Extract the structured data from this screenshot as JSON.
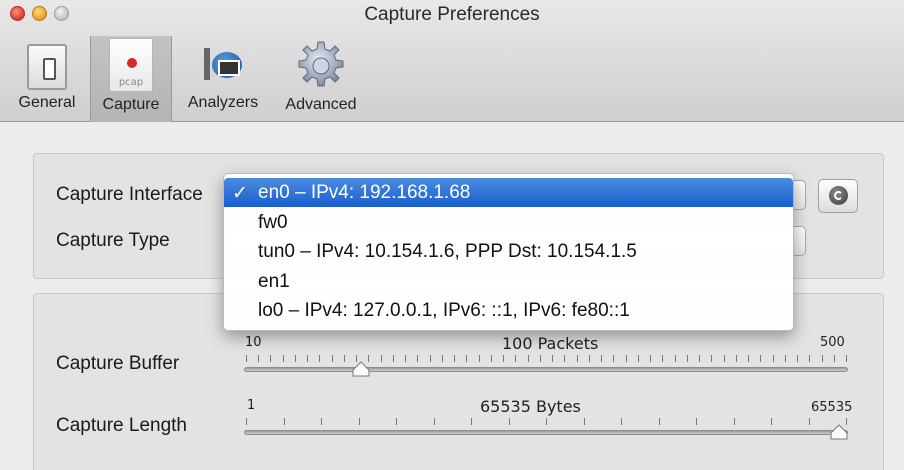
{
  "window": {
    "title": "Capture Preferences"
  },
  "toolbar": {
    "items": [
      {
        "label": "General",
        "icon": "switch-icon"
      },
      {
        "label": "Capture",
        "icon": "pcap-document-icon",
        "icon_text": "pcap",
        "selected": true
      },
      {
        "label": "Analyzers",
        "icon": "analyzers-icon"
      },
      {
        "label": "Advanced",
        "icon": "gear-icon"
      }
    ]
  },
  "interface_group": {
    "capture_interface_label": "Capture Interface",
    "capture_type_label": "Capture Type",
    "refresh_icon": "refresh-icon"
  },
  "dropdown": {
    "selected_check": "✓",
    "items": [
      {
        "text": "en0 – IPv4: 192.168.1.68",
        "selected": true
      },
      {
        "text": "fw0",
        "selected": false
      },
      {
        "text": "tun0 – IPv4: 10.154.1.6, PPP Dst: 10.154.1.5",
        "selected": false
      },
      {
        "text": "en1",
        "selected": false
      },
      {
        "text": "lo0 – IPv4: 127.0.0.1, IPv6: ::1, IPv6: fe80::1",
        "selected": false
      }
    ]
  },
  "sliders": {
    "buffer": {
      "label": "Capture Buffer",
      "min_label": "10",
      "max_label": "500",
      "value_label": "100  Packets",
      "min": 10,
      "max": 500,
      "value": 100
    },
    "length": {
      "label": "Capture Length",
      "min_label": "1",
      "max_label": "65535",
      "value_label": "65535  Bytes",
      "min": 1,
      "max": 65535,
      "value": 65535
    }
  },
  "colors": {
    "selection": "#1a5fd0",
    "capture_dot": "#d52a2a"
  }
}
